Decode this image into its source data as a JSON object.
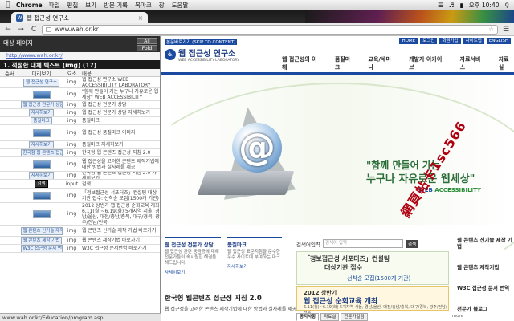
{
  "menubar": {
    "app": "Chrome",
    "items": [
      "파일",
      "편집",
      "보기",
      "방문 기록",
      "북마크",
      "창",
      "도움말"
    ],
    "clock": "오후 10:40"
  },
  "tab": {
    "title": "웹 접근성 연구소",
    "close": "×"
  },
  "nav": {
    "back": "←",
    "forward": "→",
    "reload": "C",
    "url": "www.wah.or.kr",
    "star": "☆"
  },
  "panel": {
    "title": "대상 페이지",
    "all_btn": "All",
    "fold_btn": "Fold",
    "url": "http://www.wah.or.kr/",
    "section": "1. 적절한 대체 텍스트 (img) (17)",
    "columns": [
      "순서",
      "대리보기",
      "요소",
      "내용"
    ],
    "rows": [
      {
        "num": "",
        "preview": "웹 접근성 연구소",
        "type": "img",
        "content": "웹 접근성 연구소 WEB ACCESSIBILITY LABORATORY"
      },
      {
        "num": "",
        "preview": "",
        "type": "img",
        "content": "\"함께 만들어 가는 누구나 자유로운 웹세상\" WEB ACCESSIBILITY"
      },
      {
        "num": "",
        "preview": "웹 접근성 전문가 상담",
        "type": "img",
        "content": "웹 접근성 전문가 상담"
      },
      {
        "num": "",
        "preview": "자세히보기",
        "type": "img",
        "content": "웹 접근성 전문가 상담 자세히보기"
      },
      {
        "num": "",
        "preview": "품질마크",
        "type": "img",
        "content": "품질마크"
      },
      {
        "num": "",
        "preview": "",
        "type": "img",
        "content": "웹 접근성 품질마크 이미지"
      },
      {
        "num": "",
        "preview": "자세히보기",
        "type": "img",
        "content": "품질마크 자세히보기"
      },
      {
        "num": "",
        "preview": "한국형 웹 콘텐츠 접근성 지침",
        "type": "img",
        "content": "한국형 웹 콘텐츠 접근성 지침 2.0"
      },
      {
        "num": "",
        "preview": "",
        "type": "img",
        "content": "웹 접근성을 고려한 콘텐츠 제작기법에 대한 방법과 실사례를 제공"
      },
      {
        "num": "",
        "preview": "자세히보기",
        "type": "img",
        "content": "한국형 웹 콘텐츠 접근성 지침 2.0 자세히보기"
      },
      {
        "num": "",
        "preview": "검색",
        "type": "input",
        "content": "검색"
      },
      {
        "num": "",
        "preview": "",
        "type": "img",
        "content": "「정보접근성 서포터즈」컨설팅 대상기관 접수: 선착순 모집(1500개 기관)"
      },
      {
        "num": "",
        "preview": "",
        "type": "img",
        "content": "2012 상반기 웹 접근성 순회교육 개최 6.11(월)~6.19(화) 5개지역 서울, 경남/울산, 대전/충남/충북, 대구/경북, 광주/전남/전북"
      },
      {
        "num": "",
        "preview": "웹 콘텐츠 신기술 제작 기법",
        "type": "img",
        "content": "웹 콘텐츠 신기술 제작 기법 바로가기"
      },
      {
        "num": "",
        "preview": "웹 콘텐츠 제작 기법",
        "type": "img",
        "content": "웹 콘텐츠 제작기법 바로가기"
      },
      {
        "num": "",
        "preview": "W3C 접근성 문서 번역",
        "type": "img",
        "content": "W3C 접근성 문서번역 바로가기"
      }
    ]
  },
  "status_url": "www.wah.or.kr/Education/program.asp",
  "site": {
    "skip": "본문바로가기 (SKIP TO CONTENT)",
    "toplinks": [
      "HOME",
      "로그인",
      "회원가입",
      "사이트맵",
      "ENGLISH"
    ],
    "logo_title": "웹 접근성 연구소",
    "logo_sub": "WEB ACCESSIBILITY LABORATORY",
    "gnb": [
      "웹 접근성의 이해",
      "품질마크",
      "교육/세미나",
      "개발자 아카이브",
      "자료서비스",
      "자료실"
    ],
    "slogan_1": "\"함께 만들어 가는",
    "slogan_2": "누구나 자유로운 웹세상\"",
    "slogan_web": "WEB",
    "slogan_acc": "ACCESSIBILITY",
    "box1_title": "웹 접근성 전문가 상담",
    "box1_body": "웹 접근성 관련 궁금증에 대해 전문가들이 속시원한 해결을 해드립니다.",
    "box1_more": "자세히보기",
    "box2_title": "품질마크",
    "box2_body": "웹 접근성 표준지침을 준수한 우수 사이트에 부여하는 마크",
    "box2_more": "자세히보기",
    "guide_title": "한국형 웹콘텐츠 접근성 지침 2.0",
    "guide_sub": "웹 접근성을 고려한 콘텐츠 제작기법에 대한 방법과 실사례를 제공",
    "search_label": "검색어입력",
    "search_placeholder": "검색어 입력",
    "search_btn": "검색",
    "banner1_a": "「정보접근성 서포터즈」컨설팅",
    "banner1_b": "대상기관 접수",
    "banner1_c": "선착순 모집(1500개 기관)",
    "banner2_a": "2012 상반기",
    "banner2_b": "웹 접근성 순회교육 개최",
    "banner2_c": "6.11(월)~6.19(화) 5개지역 서울, 경남/울산, 대전/충남/충북, 대구/경북, 광주/전남/전북",
    "tabs": [
      "공지사항",
      "자료실",
      "전문가칼럼"
    ],
    "tabs_more": "more",
    "right": [
      "웹 콘텐츠 신기술 제작 기법",
      "웹 콘텐츠 제작기법",
      "W3C 접근성 문서 번역",
      "전문가 블로그"
    ]
  },
  "watermark": "網頁帖卡1sc566"
}
